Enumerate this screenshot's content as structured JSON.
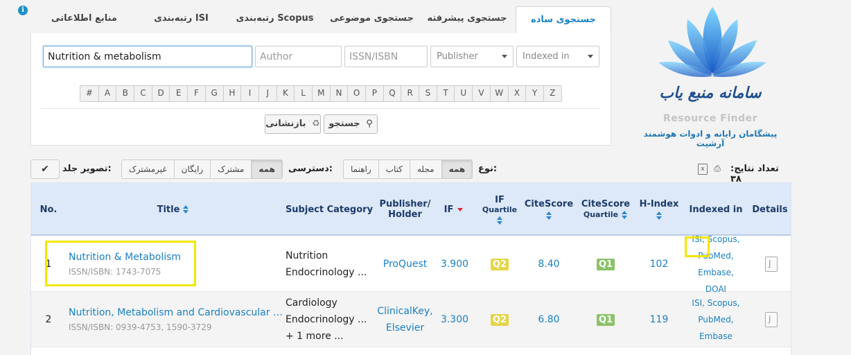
{
  "tabs": [
    {
      "label": "جستجوی ساده",
      "active": true
    },
    {
      "label": "جستجوی پیشرفته"
    },
    {
      "label": "جستجوی موضوعی"
    },
    {
      "label": "رتبه‌بندی Scopus"
    },
    {
      "label": "رتبه‌بندی ISI"
    },
    {
      "label": "منابع اطلاعاتی"
    }
  ],
  "search": {
    "title_value": "Nutrition & metabolism",
    "author_placeholder": "Author",
    "issn_placeholder": "ISSN/ISBN",
    "publisher_placeholder": "Publisher",
    "indexed_placeholder": "Indexed in",
    "alphabet": [
      "#",
      "A",
      "B",
      "C",
      "D",
      "E",
      "F",
      "G",
      "H",
      "I",
      "J",
      "K",
      "L",
      "M",
      "N",
      "O",
      "P",
      "Q",
      "R",
      "S",
      "T",
      "U",
      "V",
      "W",
      "X",
      "Y",
      "Z"
    ],
    "search_button": "جستجو",
    "reset_button": "بازنشانی"
  },
  "logo": {
    "title_fa": "سامانه منبع یاب",
    "title_en": "Resource Finder",
    "tagline": "پیشگامان رایانه و ادوات هوشمند آرشیت"
  },
  "filters": {
    "result_count_label": "تعداد نتایج: ۳۸",
    "type_label": "نوع:",
    "type_options": [
      "همه",
      "مجله",
      "کتاب",
      "راهنما"
    ],
    "access_label": "دسترسی:",
    "access_options": [
      "همه",
      "مشترک",
      "رایگان",
      "غیرمشترک"
    ],
    "cover_label": "تصویر جلد:",
    "check_glyph": "✔"
  },
  "table": {
    "headers": {
      "no": "No.",
      "title": "Title",
      "subject": "Subject Category",
      "publisher_line1": "Publisher/",
      "publisher_line2": "Holder",
      "if": "IF",
      "ifq_line1": "IF",
      "ifq_line2": "Quartile",
      "citescore": "CiteScore",
      "csq_line1": "CiteScore",
      "csq_line2": "Quartile",
      "hindex": "H-Index",
      "indexed": "Indexed in",
      "details": "Details"
    },
    "rows": [
      {
        "no": "1",
        "title": "Nutrition & Metabolism",
        "issn": "ISSN/ISBN: 1743-7075",
        "subject_1": "Nutrition",
        "subject_2": "Endocrinology ...",
        "publisher": "ProQuest",
        "if": "3.900",
        "if_quartile": "Q2",
        "citescore": "8.40",
        "cs_quartile": "Q1",
        "hindex": "102",
        "indexed_1": "ISI, Scopus,",
        "indexed_2": "PubMed, Embase,",
        "indexed_3": "DOAJ"
      },
      {
        "no": "2",
        "title": "Nutrition, Metabolism and Cardiovascular Di...",
        "issn": "ISSN/ISBN: 0939-4753, 1590-3729",
        "subject_1": "Cardiology",
        "subject_2": "Endocrinology ...",
        "subject_3": "+ 1 more ...",
        "publisher_1": "ClinicalKey,",
        "publisher_2": "Elsevier",
        "if": "3.300",
        "if_quartile": "Q2",
        "citescore": "6.80",
        "cs_quartile": "Q1",
        "hindex": "119",
        "indexed_1": "ISI, Scopus,",
        "indexed_2": "PubMed, Embase"
      }
    ]
  }
}
